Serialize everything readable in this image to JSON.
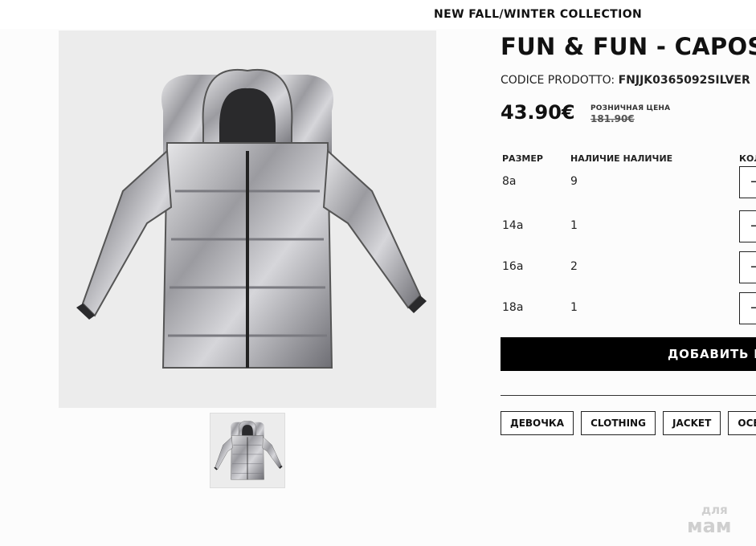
{
  "announcement": "NEW FALL/WINTER COLLECTION",
  "product": {
    "title": "FUN & FUN - CAPOSPALLA",
    "code_label": "CODICE PRODOTTO:",
    "code_value": "FNJJK0365092SILVER",
    "price": "43.90€",
    "retail_label": "РОЗНИЧНАЯ ЦЕНА",
    "retail_price": "181.90€",
    "image_icon": "silver-puffer-jacket",
    "colors": {
      "button": "#000000",
      "background": "#fcfcfc"
    }
  },
  "sizes": {
    "headers": [
      "РАЗМЕР",
      "НАЛИЧИЕ НАЛИЧИЕ",
      "КОЛ"
    ],
    "rows": [
      {
        "size": "8a",
        "qty": "9"
      },
      {
        "size": "14a",
        "qty": "1"
      },
      {
        "size": "16a",
        "qty": "2"
      },
      {
        "size": "18a",
        "qty": "1"
      }
    ],
    "stepper_minus": "−"
  },
  "add_button": "ДОБАВИТЬ В",
  "tags": [
    "ДЕВОЧКА",
    "CLOTHING",
    "JACKET",
    "ОСЕНЬ"
  ],
  "watermark": {
    "line1": "для",
    "line2": "мам"
  }
}
